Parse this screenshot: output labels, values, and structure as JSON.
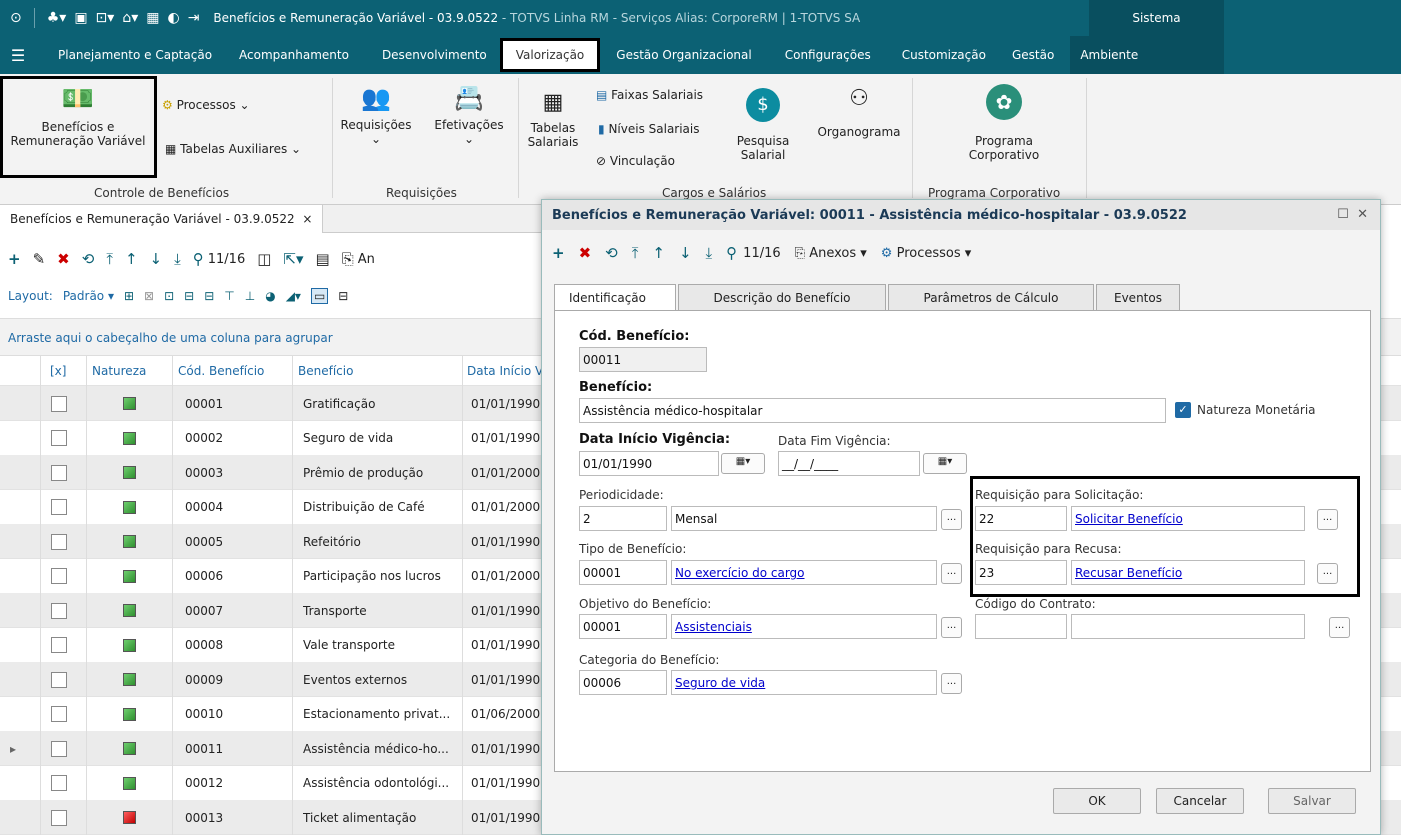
{
  "titlebar": {
    "title": "Benefícios e Remuneração Variável - 03.9.0522",
    "subtitle": " - TOTVS Linha RM - Serviços  Alias: CorporeRM | 1-TOTVS SA",
    "sistema": "Sistema"
  },
  "menu": [
    "Planejamento e Captação",
    "Acompanhamento",
    "Desenvolvimento",
    "Valorização",
    "Gestão Organizacional",
    "Configurações",
    "Customização",
    "Gestão",
    "Ambiente"
  ],
  "ribbon": {
    "beneficios": "Benefícios e\nRemuneração Variável",
    "processos": "Processos",
    "tabelas_aux": "Tabelas Auxiliares",
    "controle": "Controle de Benefícios",
    "requisicoes": "Requisições",
    "efetivacoes": "Efetivações",
    "requisicoes_group": "Requisições",
    "tabelas_salariais": "Tabelas\nSalariais",
    "faixas": "Faixas Salariais",
    "niveis": "Níveis Salariais",
    "vinculacao": "Vinculação",
    "pesquisa": "Pesquisa\nSalarial",
    "organograma": "Organograma",
    "cargos_group": "Cargos e Salários",
    "programa": "Programa\nCorporativo",
    "programa_group": "Programa Corporativo"
  },
  "doctab": "Benefícios e Remuneração Variável - 03.9.0522",
  "toolbar": {
    "counter": "11/16",
    "anexos_trunc": "An",
    "layout": "Layout:",
    "padrao": "Padrão"
  },
  "groupbar": "Arraste aqui o cabeçalho de uma coluna para agrupar",
  "grid": {
    "headers": {
      "sel": "[x]",
      "natureza": "Natureza",
      "cod": "Cód. Benefício",
      "beneficio": "Benefício",
      "data": "Data Início V"
    },
    "rows": [
      {
        "cod": "00001",
        "beneficio": "Gratificação",
        "data": "01/01/1990",
        "red": false
      },
      {
        "cod": "00002",
        "beneficio": "Seguro de vida",
        "data": "01/01/1990",
        "red": false
      },
      {
        "cod": "00003",
        "beneficio": "Prêmio de produção",
        "data": "01/01/2000",
        "red": false
      },
      {
        "cod": "00004",
        "beneficio": "Distribuição de Café",
        "data": "01/01/2000",
        "red": false
      },
      {
        "cod": "00005",
        "beneficio": "Refeitório",
        "data": "01/01/1990",
        "red": false
      },
      {
        "cod": "00006",
        "beneficio": "Participação nos lucros",
        "data": "01/01/2000",
        "red": false
      },
      {
        "cod": "00007",
        "beneficio": "Transporte",
        "data": "01/01/1990",
        "red": false
      },
      {
        "cod": "00008",
        "beneficio": "Vale transporte",
        "data": "01/01/1990",
        "red": false
      },
      {
        "cod": "00009",
        "beneficio": "Eventos externos",
        "data": "01/01/1990",
        "red": false
      },
      {
        "cod": "00010",
        "beneficio": "Estacionamento privat...",
        "data": "01/06/2000",
        "red": false
      },
      {
        "cod": "00011",
        "beneficio": "Assistência médico-ho...",
        "data": "01/01/1990",
        "red": false
      },
      {
        "cod": "00012",
        "beneficio": "Assistência odontológi...",
        "data": "01/01/1990",
        "red": false
      },
      {
        "cod": "00013",
        "beneficio": "Ticket alimentação",
        "data": "01/01/1990",
        "red": true
      }
    ]
  },
  "modal": {
    "title": "Benefícios e Remuneração Variável: 00011 - Assistência médico-hospitalar - 03.9.0522",
    "counter": "11/16",
    "anexos": "Anexos",
    "processos": "Processos",
    "tabs": [
      "Identificação",
      "Descrição do Benefício",
      "Parâmetros de Cálculo",
      "Eventos"
    ],
    "cod_label": "Cód. Benefício:",
    "cod_value": "00011",
    "benef_label": "Benefício:",
    "benef_value": "Assistência médico-hospitalar",
    "natureza_monetaria": "Natureza Monetária",
    "data_inicio_label": "Data Início Vigência:",
    "data_inicio_value": "01/01/1990",
    "data_fim_label": "Data Fim Vigência:",
    "data_fim_value": "__/__/____",
    "periodicidade_label": "Periodicidade:",
    "periodicidade_code": "2",
    "periodicidade_desc": "Mensal",
    "tipo_label": "Tipo de Benefício:",
    "tipo_code": "00001",
    "tipo_desc": "No exercício do cargo",
    "objetivo_label": "Objetivo do Benefício:",
    "objetivo_code": "00001",
    "objetivo_desc": "Assistenciais",
    "categoria_label": "Categoria do Benefício:",
    "categoria_code": "00006",
    "categoria_desc": "Seguro de vida",
    "req_sol_label": "Requisição para Solicitação:",
    "req_sol_code": "22",
    "req_sol_desc": "Solicitar Benefício",
    "req_rec_label": "Requisição para Recusa:",
    "req_rec_code": "23",
    "req_rec_desc": "Recusar Benefício",
    "contrato_label": "Código do Contrato:",
    "ok": "OK",
    "cancelar": "Cancelar",
    "salvar": "Salvar"
  }
}
